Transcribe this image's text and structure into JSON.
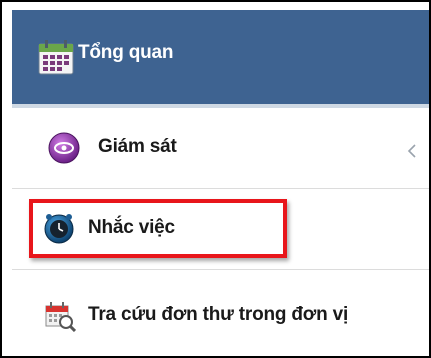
{
  "header": {
    "title": "Tổng quan",
    "icon": "calendar-icon",
    "background_color": "#3e6391"
  },
  "menu": {
    "items": [
      {
        "label": "Giám sát",
        "icon": "eye-monitor-icon",
        "has_chevron": true
      },
      {
        "label": "Nhắc việc",
        "icon": "alarm-clock-icon",
        "highlighted": true
      },
      {
        "label": "Tra cứu đơn thư trong đơn vị",
        "icon": "calendar-search-icon"
      }
    ]
  },
  "highlight_color": "#e8161b"
}
